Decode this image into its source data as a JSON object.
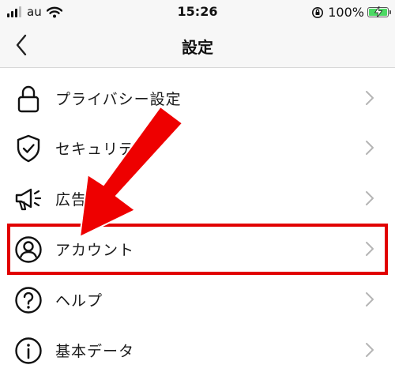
{
  "status_bar": {
    "carrier": "au",
    "time": "15:26",
    "battery_percent": "100%",
    "battery_level": 1.0,
    "battery_color": "#4cd964"
  },
  "nav": {
    "title": "設定",
    "back_icon": "chevron-left-icon"
  },
  "menu_items": [
    {
      "label": "プライバシー設定",
      "icon": "lock-icon"
    },
    {
      "label": "セキュリティ",
      "icon": "shield-check-icon"
    },
    {
      "label": "広告",
      "icon": "megaphone-icon"
    },
    {
      "label": "アカウント",
      "icon": "account-circle-icon",
      "highlighted": true
    },
    {
      "label": "ヘルプ",
      "icon": "help-circle-icon"
    },
    {
      "label": "基本データ",
      "icon": "info-circle-icon"
    }
  ],
  "annotation": {
    "highlight_color": "#e10000",
    "arrow_color": "#ee0000"
  }
}
